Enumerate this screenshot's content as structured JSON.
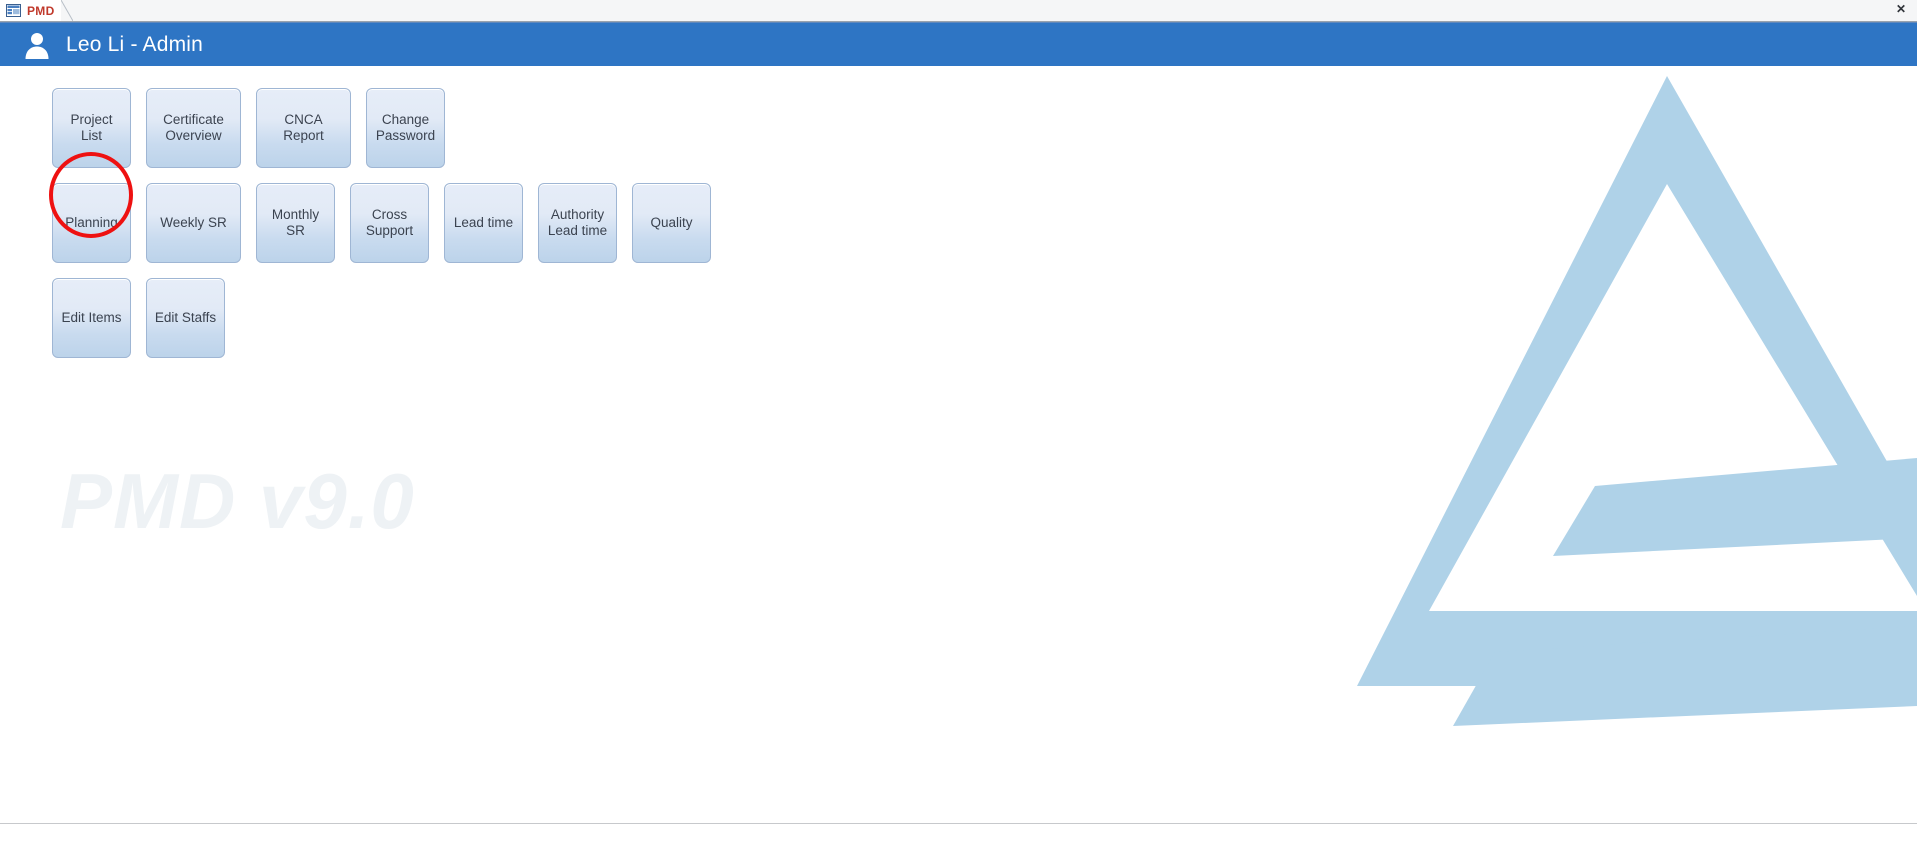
{
  "window": {
    "tab": {
      "label": "PMD",
      "icon": "access-form-icon"
    },
    "close_label": "✕"
  },
  "header": {
    "user_name": "Leo Li - Admin",
    "avatar_icon": "user-avatar-icon",
    "background_color": "#2e75c4"
  },
  "main": {
    "watermark": "PMD v9.0",
    "logo_icon": "triangle-delta-logo",
    "logo_color": "#afd2e8",
    "button_rows": [
      {
        "buttons": [
          {
            "label": "Project List",
            "width_class": "w-w80",
            "annotated": true
          },
          {
            "label": "Certificate Overview",
            "width_class": "w-w95",
            "annotated": false
          },
          {
            "label": "CNCA Report",
            "width_class": "w-w80",
            "annotated": false
          },
          {
            "label": "Change Password",
            "width_class": "w-w80",
            "annotated": false
          }
        ]
      },
      {
        "buttons": [
          {
            "label": "Planning",
            "width_class": "w-w80",
            "annotated": false
          },
          {
            "label": "Weekly SR",
            "width_class": "w-w95",
            "annotated": false
          },
          {
            "label": "Monthly SR",
            "width_class": "w-w80",
            "annotated": false
          },
          {
            "label": "Cross Support",
            "width_class": "w-w80",
            "annotated": false
          },
          {
            "label": "Lead time",
            "width_class": "w-w80",
            "annotated": false
          },
          {
            "label": "Authority Lead time",
            "width_class": "w-w80",
            "annotated": false
          },
          {
            "label": "Quality",
            "width_class": "w-w80",
            "annotated": false
          }
        ]
      },
      {
        "buttons": [
          {
            "label": "Edit Items",
            "width_class": "w-w80",
            "annotated": false
          },
          {
            "label": "Edit Staffs",
            "width_class": "w-w80",
            "annotated": false
          }
        ]
      }
    ]
  },
  "statusbar": {
    "text": ""
  }
}
